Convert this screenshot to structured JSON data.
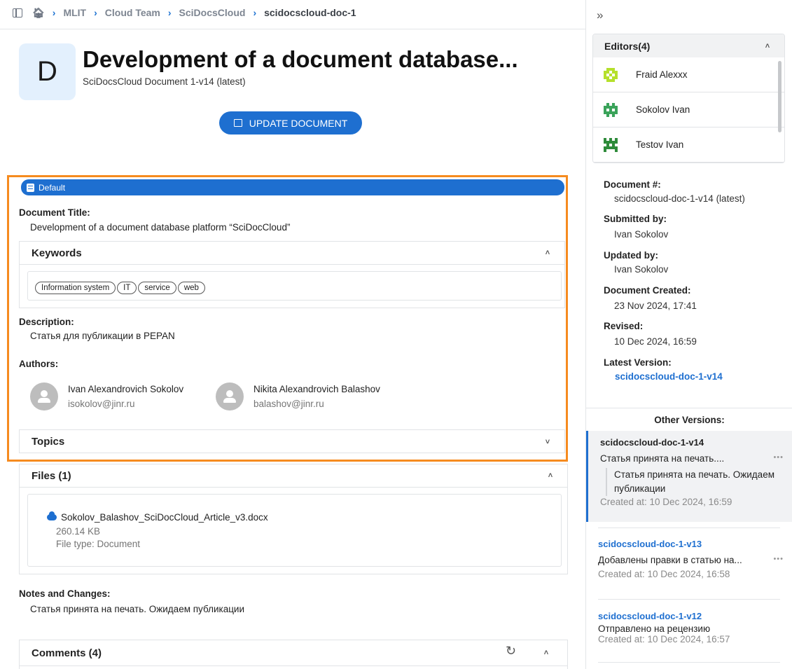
{
  "breadcrumb": {
    "items": [
      "MLIT",
      "Cloud Team",
      "SciDocsCloud"
    ],
    "current": "scidocscloud-doc-1"
  },
  "document": {
    "avatar_letter": "D",
    "title": "Development of a document database...",
    "subtitle": "SciDocsCloud Document 1-v14 (latest)",
    "update_label": "UPDATE DOCUMENT"
  },
  "default_section": {
    "badge": "Default",
    "title_label": "Document Title:",
    "title_value": "Development of a document database platform “SciDocCloud”",
    "keywords_header": "Keywords",
    "keywords": [
      "Information system",
      "IT",
      "service",
      "web"
    ],
    "description_label": "Description:",
    "description_value": "Статья для публикации в PEPAN",
    "authors_label": "Authors:",
    "authors": [
      {
        "name": "Ivan Alexandrovich Sokolov",
        "email": "isokolov@jinr.ru"
      },
      {
        "name": "Nikita Alexandrovich Balashov",
        "email": "balashov@jinr.ru"
      }
    ],
    "topics_header": "Topics"
  },
  "files": {
    "header": "Files (1)",
    "name": "Sokolov_Balashov_SciDocCloud_Article_v3.docx",
    "size": "260.14 KB",
    "type": "File type: Document"
  },
  "notes": {
    "label": "Notes and Changes:",
    "value": "Статья принята на печать. Ожидаем публикации"
  },
  "comments": {
    "header": "Comments (4)"
  },
  "sidebar": {
    "editors_header": "Editors(4)",
    "editors": [
      "Fraid Alexxx",
      "Sokolov Ivan",
      "Testov Ivan"
    ],
    "meta": {
      "doc_num_label": "Document #:",
      "doc_num_value": "scidocscloud-doc-1-v14 (latest)",
      "submitted_label": "Submitted by:",
      "submitted_value": "Ivan Sokolov",
      "updated_label": "Updated by:",
      "updated_value": "Ivan Sokolov",
      "created_label": "Document Created:",
      "created_value": "23 Nov 2024, 17:41",
      "revised_label": "Revised:",
      "revised_value": "10 Dec 2024, 16:59",
      "latest_label": "Latest Version:",
      "latest_value": "scidocscloud-doc-1-v14"
    },
    "other_versions_label": "Other Versions:",
    "versions": [
      {
        "title": "scidocscloud-doc-1-v14",
        "note": "Статья принята на печать....",
        "quote": "Статья принята на печать. Ожидаем публикации",
        "created": "Created at: 10 Dec 2024, 16:59"
      },
      {
        "title": "scidocscloud-doc-1-v13",
        "note": "Добавлены правки в статью на...",
        "created": "Created at: 10 Dec 2024, 16:58"
      },
      {
        "title": "scidocscloud-doc-1-v12",
        "note": "Отправлено на рецензию",
        "created": "Created at: 10 Dec 2024, 16:57"
      }
    ]
  },
  "colors": {
    "accent": "#1e6fd0",
    "highlight": "#f68b1f",
    "identicon_1": "#b5e02c",
    "identicon_2": "#3aa35a",
    "identicon_3": "#2e8b3a"
  },
  "icons": {
    "panel": "sidebar-toggle-icon",
    "home": "home-icon",
    "collapse": "double-chevron-right-icon",
    "file": "cloud-upload-icon",
    "refresh": "refresh-icon"
  }
}
